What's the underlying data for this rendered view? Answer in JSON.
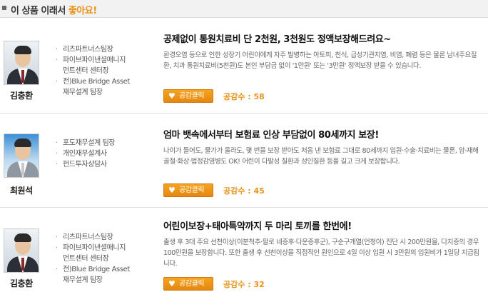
{
  "header": {
    "prefix": "이 상품 이래서",
    "highlight": "좋아요!"
  },
  "colors": {
    "accent": "#e8931a",
    "button": "#f19a1b"
  },
  "reviews": [
    {
      "name": "김충환",
      "profile": [
        "리츠파트너스팀장",
        "파이브파이낸셜매니지",
        "먼트센터 센터장",
        "전)Blue Bridge Asset",
        "재무설계 팀장"
      ],
      "title": "공제없이 통원치료비 단 2천원, 3천원도 정액보장해드려요~",
      "desc": "환경오염 등으로 인한 성장기 어린이에게 자주 발병하는 아토피, 천식, 급성기관지염, 비염, 폐렴 등은 물론 남녀주요질환, 치과 통원치료비(5천원)도 본인 부담금 없이 '1만원' 또는 '3만원' 정액보장 받을 수 있습니다.",
      "button": "공감클릭",
      "count_label": "공감수 :",
      "count": "58"
    },
    {
      "name": "최원석",
      "profile": [
        "포도재무설계 팀장",
        "개인재무설계사",
        "펀드투자상담사"
      ],
      "title": "엄마 뱃속에서부터 보험료 인상 부담없이 80세까지 보장!",
      "desc": "나이가 들어도, 물가가 올라도, 몇 번을 보장 받아도 처음 낸 보험료 그대로 80세까지 입원·수술·치료비는 물론, 암·재해골절·화상·법정감염병도 OK! 어린이 다발성 질환과 성인질환 등을 길고 크게 보장합니다.",
      "button": "공감클릭",
      "count_label": "공감수 :",
      "count": "45"
    },
    {
      "name": "김충환",
      "profile": [
        "리츠파트너스팀장",
        "파이브파이낸셜매니지",
        "먼트센터 센터장",
        "전)Blue Bridge Asset",
        "재무설계 팀장"
      ],
      "title": "어린이보장+태아특약까지 두 마리 토끼를 한번에!",
      "desc": "출생 후 3대 주요 선천이상(이분척추·팔로 네증후·다운증후군), 구순구개열(언청이) 진단 시 200만원을, 다지증의 경우 100만원을 보장합니다. 또한 출생 후 선천이상을 직접적인 원인으로 4일 이상 입원 시 3만원의 입원비가 1일당 지급됩니다.",
      "button": "공감클릭",
      "count_label": "공감수 :",
      "count": "32"
    }
  ]
}
